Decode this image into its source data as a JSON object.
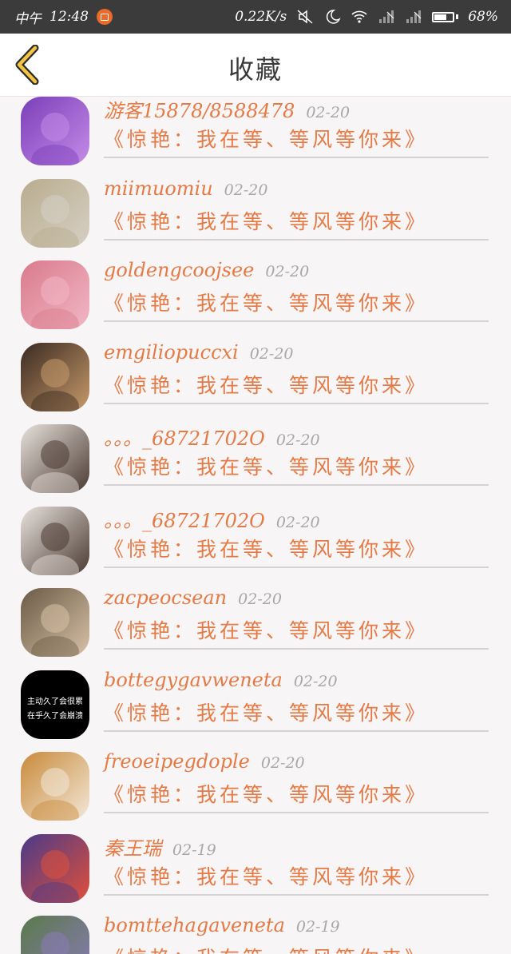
{
  "status_bar": {
    "carrier": "中午",
    "time": "12:48",
    "speed": "0.22K/s",
    "battery": "68%",
    "battery_level": 0.68
  },
  "header": {
    "title": "收藏",
    "back_icon": "chevron-left-icon"
  },
  "items": [
    {
      "username": "游客15878/8588478",
      "date": "02-20",
      "title": "《惊艳：我在等、等风等你来》",
      "avatar_colors": [
        "#7b3fb8",
        "#c58be8"
      ]
    },
    {
      "username": "miimuomiu",
      "date": "02-20",
      "title": "《惊艳：我在等、等风等你来》",
      "avatar_colors": [
        "#b9ad8e",
        "#d6cfc4"
      ]
    },
    {
      "username": "goldengcoojsee",
      "date": "02-20",
      "title": "《惊艳：我在等、等风等你来》",
      "avatar_colors": [
        "#d97a8c",
        "#f2b7c4"
      ]
    },
    {
      "username": "emgiliopuccxi",
      "date": "02-20",
      "title": "《惊艳：我在等、等风等你来》",
      "avatar_colors": [
        "#3a2a22",
        "#c79a6a"
      ]
    },
    {
      "username": "。。。_68721702O",
      "date": "02-20",
      "title": "《惊艳：我在等、等风等你来》",
      "avatar_colors": [
        "#e8e2dc",
        "#4a3a32"
      ]
    },
    {
      "username": "。。。_68721702O",
      "date": "02-20",
      "title": "《惊艳：我在等、等风等你来》",
      "avatar_colors": [
        "#e8e2dc",
        "#4a3a32"
      ]
    },
    {
      "username": "zacpeocsean",
      "date": "02-20",
      "title": "《惊艳：我在等、等风等你来》",
      "avatar_colors": [
        "#6a5a45",
        "#d8c2a8"
      ]
    },
    {
      "username": "bottegygavweneta",
      "date": "02-20",
      "title": "《惊艳：我在等、等风等你来》",
      "avatar_colors": [
        "#000000",
        "#000000"
      ],
      "avatar_text": [
        "主动久了会很累",
        "在乎久了会崩溃"
      ]
    },
    {
      "username": "freoeipegdople",
      "date": "02-20",
      "title": "《惊艳：我在等、等风等你来》",
      "avatar_colors": [
        "#c98a3a",
        "#f2e8d8"
      ]
    },
    {
      "username": "秦王瑞",
      "date": "02-19",
      "title": "《惊艳：我在等、等风等你来》",
      "avatar_colors": [
        "#4a3a8a",
        "#e0503a"
      ]
    },
    {
      "username": "bomttehagaveneta",
      "date": "02-19",
      "title": "《惊艳：我在等、等风等你来》",
      "avatar_colors": [
        "#5a7a4a",
        "#8a7ab8"
      ]
    }
  ]
}
